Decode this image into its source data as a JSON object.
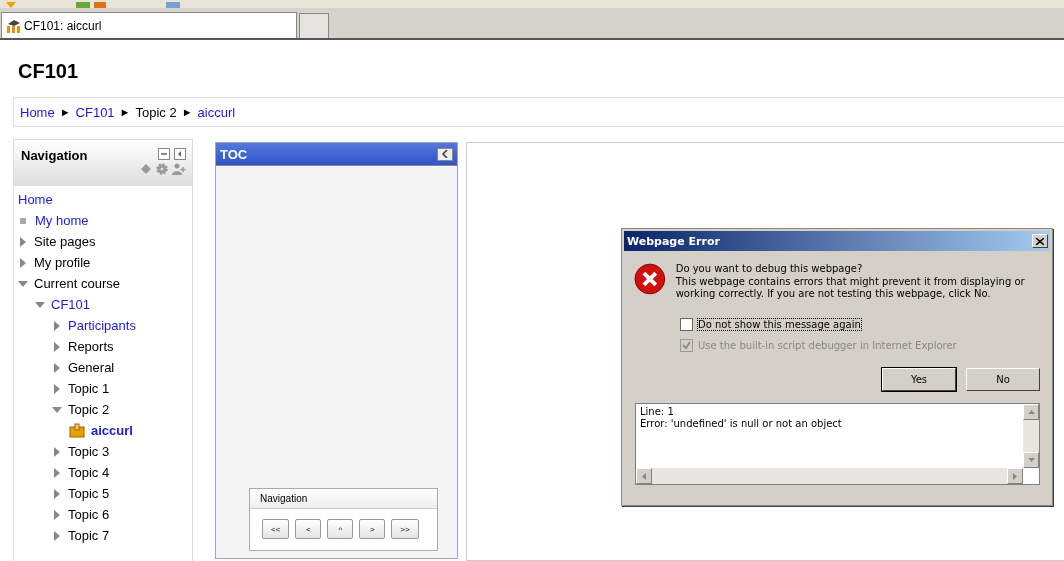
{
  "browser": {
    "tab": {
      "title": "CF101: aiccurl"
    }
  },
  "page": {
    "heading": "CF101",
    "breadcrumb": [
      {
        "label": "Home",
        "link": true
      },
      {
        "label": "CF101",
        "link": true
      },
      {
        "label": "Topic 2",
        "link": false
      },
      {
        "label": "aiccurl",
        "link": true
      }
    ],
    "breadcrumb_separator": "►",
    "navigation": {
      "title": "Navigation",
      "items": [
        {
          "label": "Home",
          "kind": "plain",
          "link": true
        },
        {
          "label": "My home",
          "kind": "bullet",
          "link": true
        },
        {
          "label": "Site pages",
          "kind": "branch",
          "link": false,
          "expanded": false
        },
        {
          "label": "My profile",
          "kind": "branch",
          "link": false,
          "expanded": false
        },
        {
          "label": "Current course",
          "kind": "branch",
          "link": false,
          "expanded": true,
          "children": [
            {
              "label": "CF101",
              "kind": "branch",
              "link": true,
              "expanded": true,
              "children": [
                {
                  "label": "Participants",
                  "kind": "branch",
                  "link": true,
                  "expanded": false
                },
                {
                  "label": "Reports",
                  "kind": "branch",
                  "link": false,
                  "expanded": false
                },
                {
                  "label": "General",
                  "kind": "branch",
                  "link": false,
                  "expanded": false
                },
                {
                  "label": "Topic 1",
                  "kind": "branch",
                  "link": false,
                  "expanded": false
                },
                {
                  "label": "Topic 2",
                  "kind": "branch",
                  "link": false,
                  "expanded": true,
                  "children": [
                    {
                      "label": "aiccurl",
                      "kind": "activity",
                      "link": true
                    }
                  ]
                },
                {
                  "label": "Topic 3",
                  "kind": "branch",
                  "link": false,
                  "expanded": false
                },
                {
                  "label": "Topic 4",
                  "kind": "branch",
                  "link": false,
                  "expanded": false
                },
                {
                  "label": "Topic 5",
                  "kind": "branch",
                  "link": false,
                  "expanded": false
                },
                {
                  "label": "Topic 6",
                  "kind": "branch",
                  "link": false,
                  "expanded": false
                },
                {
                  "label": "Topic 7",
                  "kind": "branch",
                  "link": false,
                  "expanded": false
                }
              ]
            }
          ]
        }
      ]
    },
    "toc": {
      "title": "TOC",
      "nav_panel": {
        "title": "Navigation",
        "buttons": [
          "<<",
          "<",
          "^",
          ">",
          ">>"
        ]
      }
    }
  },
  "dialog": {
    "title": "Webpage Error",
    "question": "Do you want to debug this webpage?",
    "message": "This webpage contains errors that might prevent it from displaying or working correctly. If you are not testing this webpage, click No.",
    "checkboxes": [
      {
        "label": "Do not show this message again",
        "checked": false,
        "disabled": false
      },
      {
        "label": "Use the built-in script debugger in Internet Explorer",
        "checked": true,
        "disabled": true
      }
    ],
    "buttons": [
      "Yes",
      "No"
    ],
    "details": [
      "Line: 1",
      "Error: 'undefined' is null or not an object"
    ]
  }
}
